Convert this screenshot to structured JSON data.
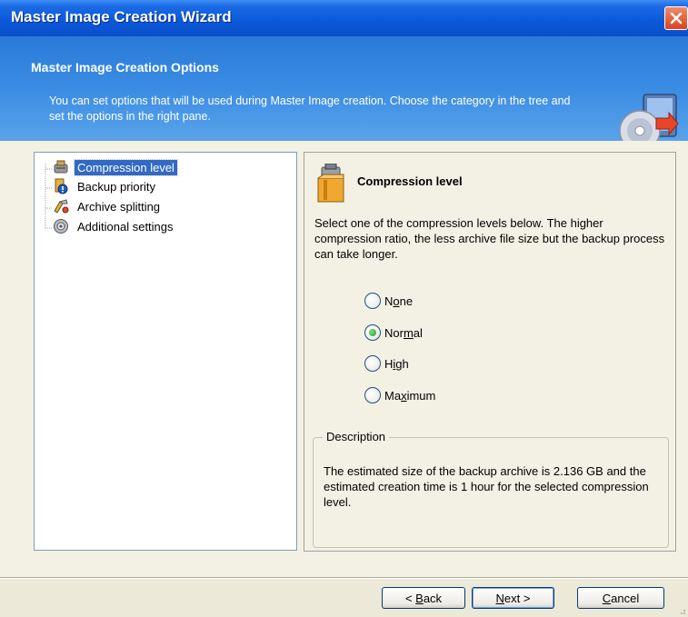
{
  "window": {
    "title": "Master Image Creation Wizard"
  },
  "header": {
    "title": "Master Image Creation Options",
    "description": "You can set options that will be used during Master Image creation. Choose the category in the tree and set the options in the right pane."
  },
  "tree": {
    "items": [
      {
        "label": "Compression level",
        "icon": "compression-icon",
        "selected": true
      },
      {
        "label": "Backup priority",
        "icon": "priority-icon",
        "selected": false
      },
      {
        "label": "Archive splitting",
        "icon": "splitting-icon",
        "selected": false
      },
      {
        "label": "Additional settings",
        "icon": "settings-icon",
        "selected": false
      }
    ]
  },
  "panel": {
    "title": "Compression level",
    "instructions": "Select one of the compression levels below. The higher compression ratio, the less archive file size but the backup process can take longer.",
    "options": [
      {
        "label": "None",
        "mnemonic": "o",
        "checked": false
      },
      {
        "label": "Normal",
        "mnemonic": "m",
        "checked": true
      },
      {
        "label": "High",
        "mnemonic": "i",
        "checked": false
      },
      {
        "label": "Maximum",
        "mnemonic": "x",
        "checked": false
      }
    ],
    "description_label": "Description",
    "description_text": "The estimated size of the backup archive is 2.136 GB and the estimated creation time is 1 hour for the selected compression level."
  },
  "buttons": {
    "back": "< Back",
    "next": "Next >",
    "cancel": "Cancel"
  },
  "colors": {
    "titlebar": "#0a58d8",
    "header": "#3a8ce3",
    "selection": "#316ac5"
  }
}
